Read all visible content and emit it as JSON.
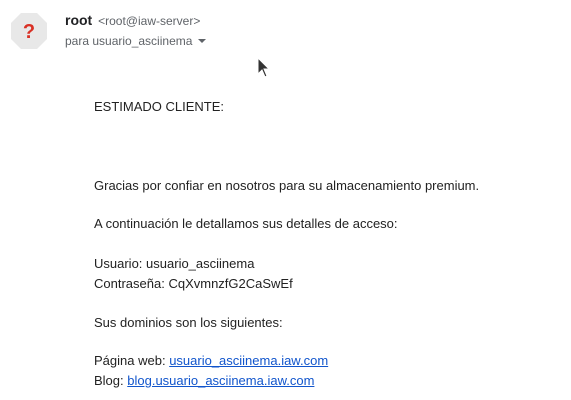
{
  "header": {
    "sender_name": "root",
    "sender_email": "<root@iaw-server>",
    "recipient_line": "para usuario_asciinema"
  },
  "avatar": {
    "glyph": "?",
    "bg_color": "#e8e8e8",
    "glyph_color": "#d93025"
  },
  "message": {
    "greeting": "ESTIMADO CLIENTE:",
    "thanks": "Gracias por confiar en nosotros para su almacenamiento premium.",
    "details_intro": "A continuación le detallamos sus detalles de acceso:",
    "user_label": "Usuario:",
    "user_value": "usuario_asciinema",
    "password_label": "Contraseña:",
    "password_value": "CqXvmnzfG2CaSwEf",
    "domains_intro": "Sus dominios son los siguientes:",
    "web_label": "Página web:",
    "web_link": "usuario_asciinema.iaw.com",
    "blog_label": "Blog:",
    "blog_link": "blog.usuario_asciinema.iaw.com"
  },
  "colors": {
    "link": "#1155cc",
    "text": "#222222",
    "secondary": "#5f6368"
  }
}
